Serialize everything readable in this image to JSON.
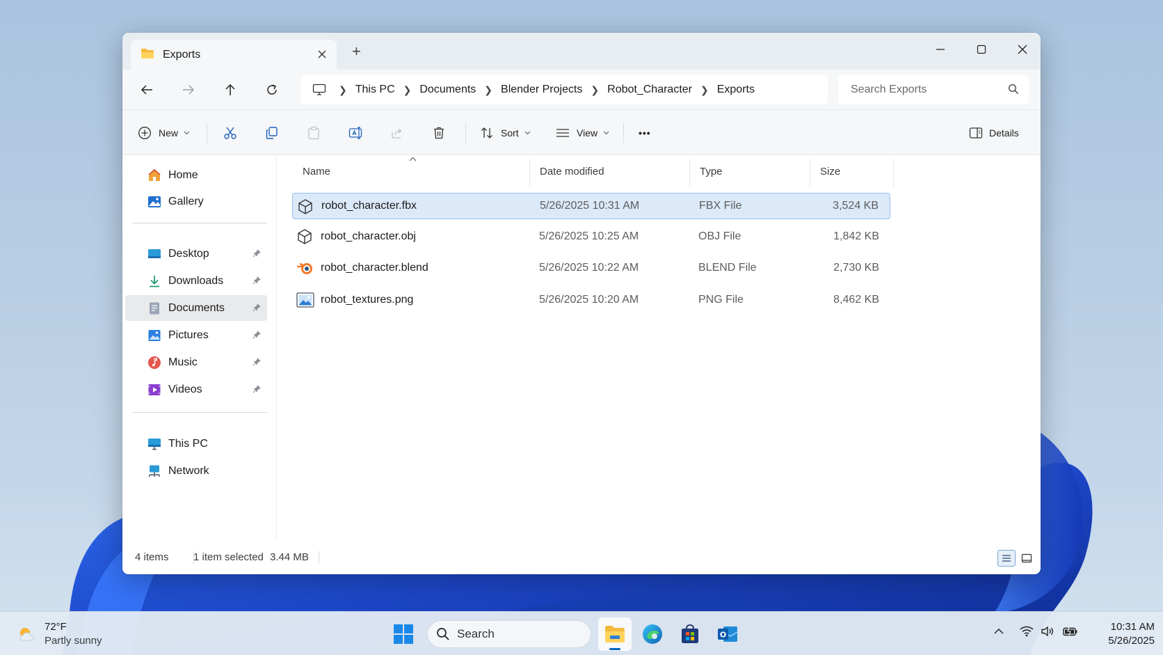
{
  "window": {
    "tab_title": "Exports",
    "new_tab": "+"
  },
  "breadcrumb": [
    "This PC",
    "Documents",
    "Blender Projects",
    "Robot_Character",
    "Exports"
  ],
  "search": {
    "placeholder": "Search Exports"
  },
  "toolbar": {
    "new_label": "New",
    "sort_label": "Sort",
    "view_label": "View",
    "details_label": "Details",
    "more_label": "•••"
  },
  "sidebar": {
    "top": [
      {
        "label": "Home",
        "icon": "home-icon"
      },
      {
        "label": "Gallery",
        "icon": "gallery-icon"
      }
    ],
    "pinned": [
      {
        "label": "Desktop",
        "icon": "desktop-icon"
      },
      {
        "label": "Downloads",
        "icon": "downloads-icon"
      },
      {
        "label": "Documents",
        "icon": "documents-icon",
        "active": true
      },
      {
        "label": "Pictures",
        "icon": "pictures-icon"
      },
      {
        "label": "Music",
        "icon": "music-icon"
      },
      {
        "label": "Videos",
        "icon": "videos-icon"
      }
    ],
    "bottom": [
      {
        "label": "This PC",
        "icon": "this-pc-icon"
      },
      {
        "label": "Network",
        "icon": "network-icon"
      }
    ]
  },
  "columns": [
    "Name",
    "Date modified",
    "Type",
    "Size"
  ],
  "files": [
    {
      "name": "robot_character.fbx",
      "date": "5/26/2025 10:31 AM",
      "type": "FBX File",
      "size": "3,524 KB",
      "icon": "3d-object-icon",
      "selected": true
    },
    {
      "name": "robot_character.obj",
      "date": "5/26/2025 10:25 AM",
      "type": "OBJ File",
      "size": "1,842 KB",
      "icon": "3d-object-icon"
    },
    {
      "name": "robot_character.blend",
      "date": "5/26/2025 10:22 AM",
      "type": "BLEND File",
      "size": "2,730 KB",
      "icon": "blender-icon"
    },
    {
      "name": "robot_textures.png",
      "date": "5/26/2025 10:20 AM",
      "type": "PNG File",
      "size": "8,462 KB",
      "icon": "image-file-icon"
    }
  ],
  "status": {
    "count": "4 items",
    "selected": "1 item selected",
    "size": "3.44 MB"
  },
  "taskbar": {
    "temp": "72°F",
    "condition": "Partly sunny",
    "search_label": "Search",
    "time": "10:31 AM",
    "date": "5/26/2025"
  },
  "colors": {
    "accent": "#0067c0",
    "selection_bg": "#dbe9f8",
    "selection_border": "#98c1ef"
  }
}
